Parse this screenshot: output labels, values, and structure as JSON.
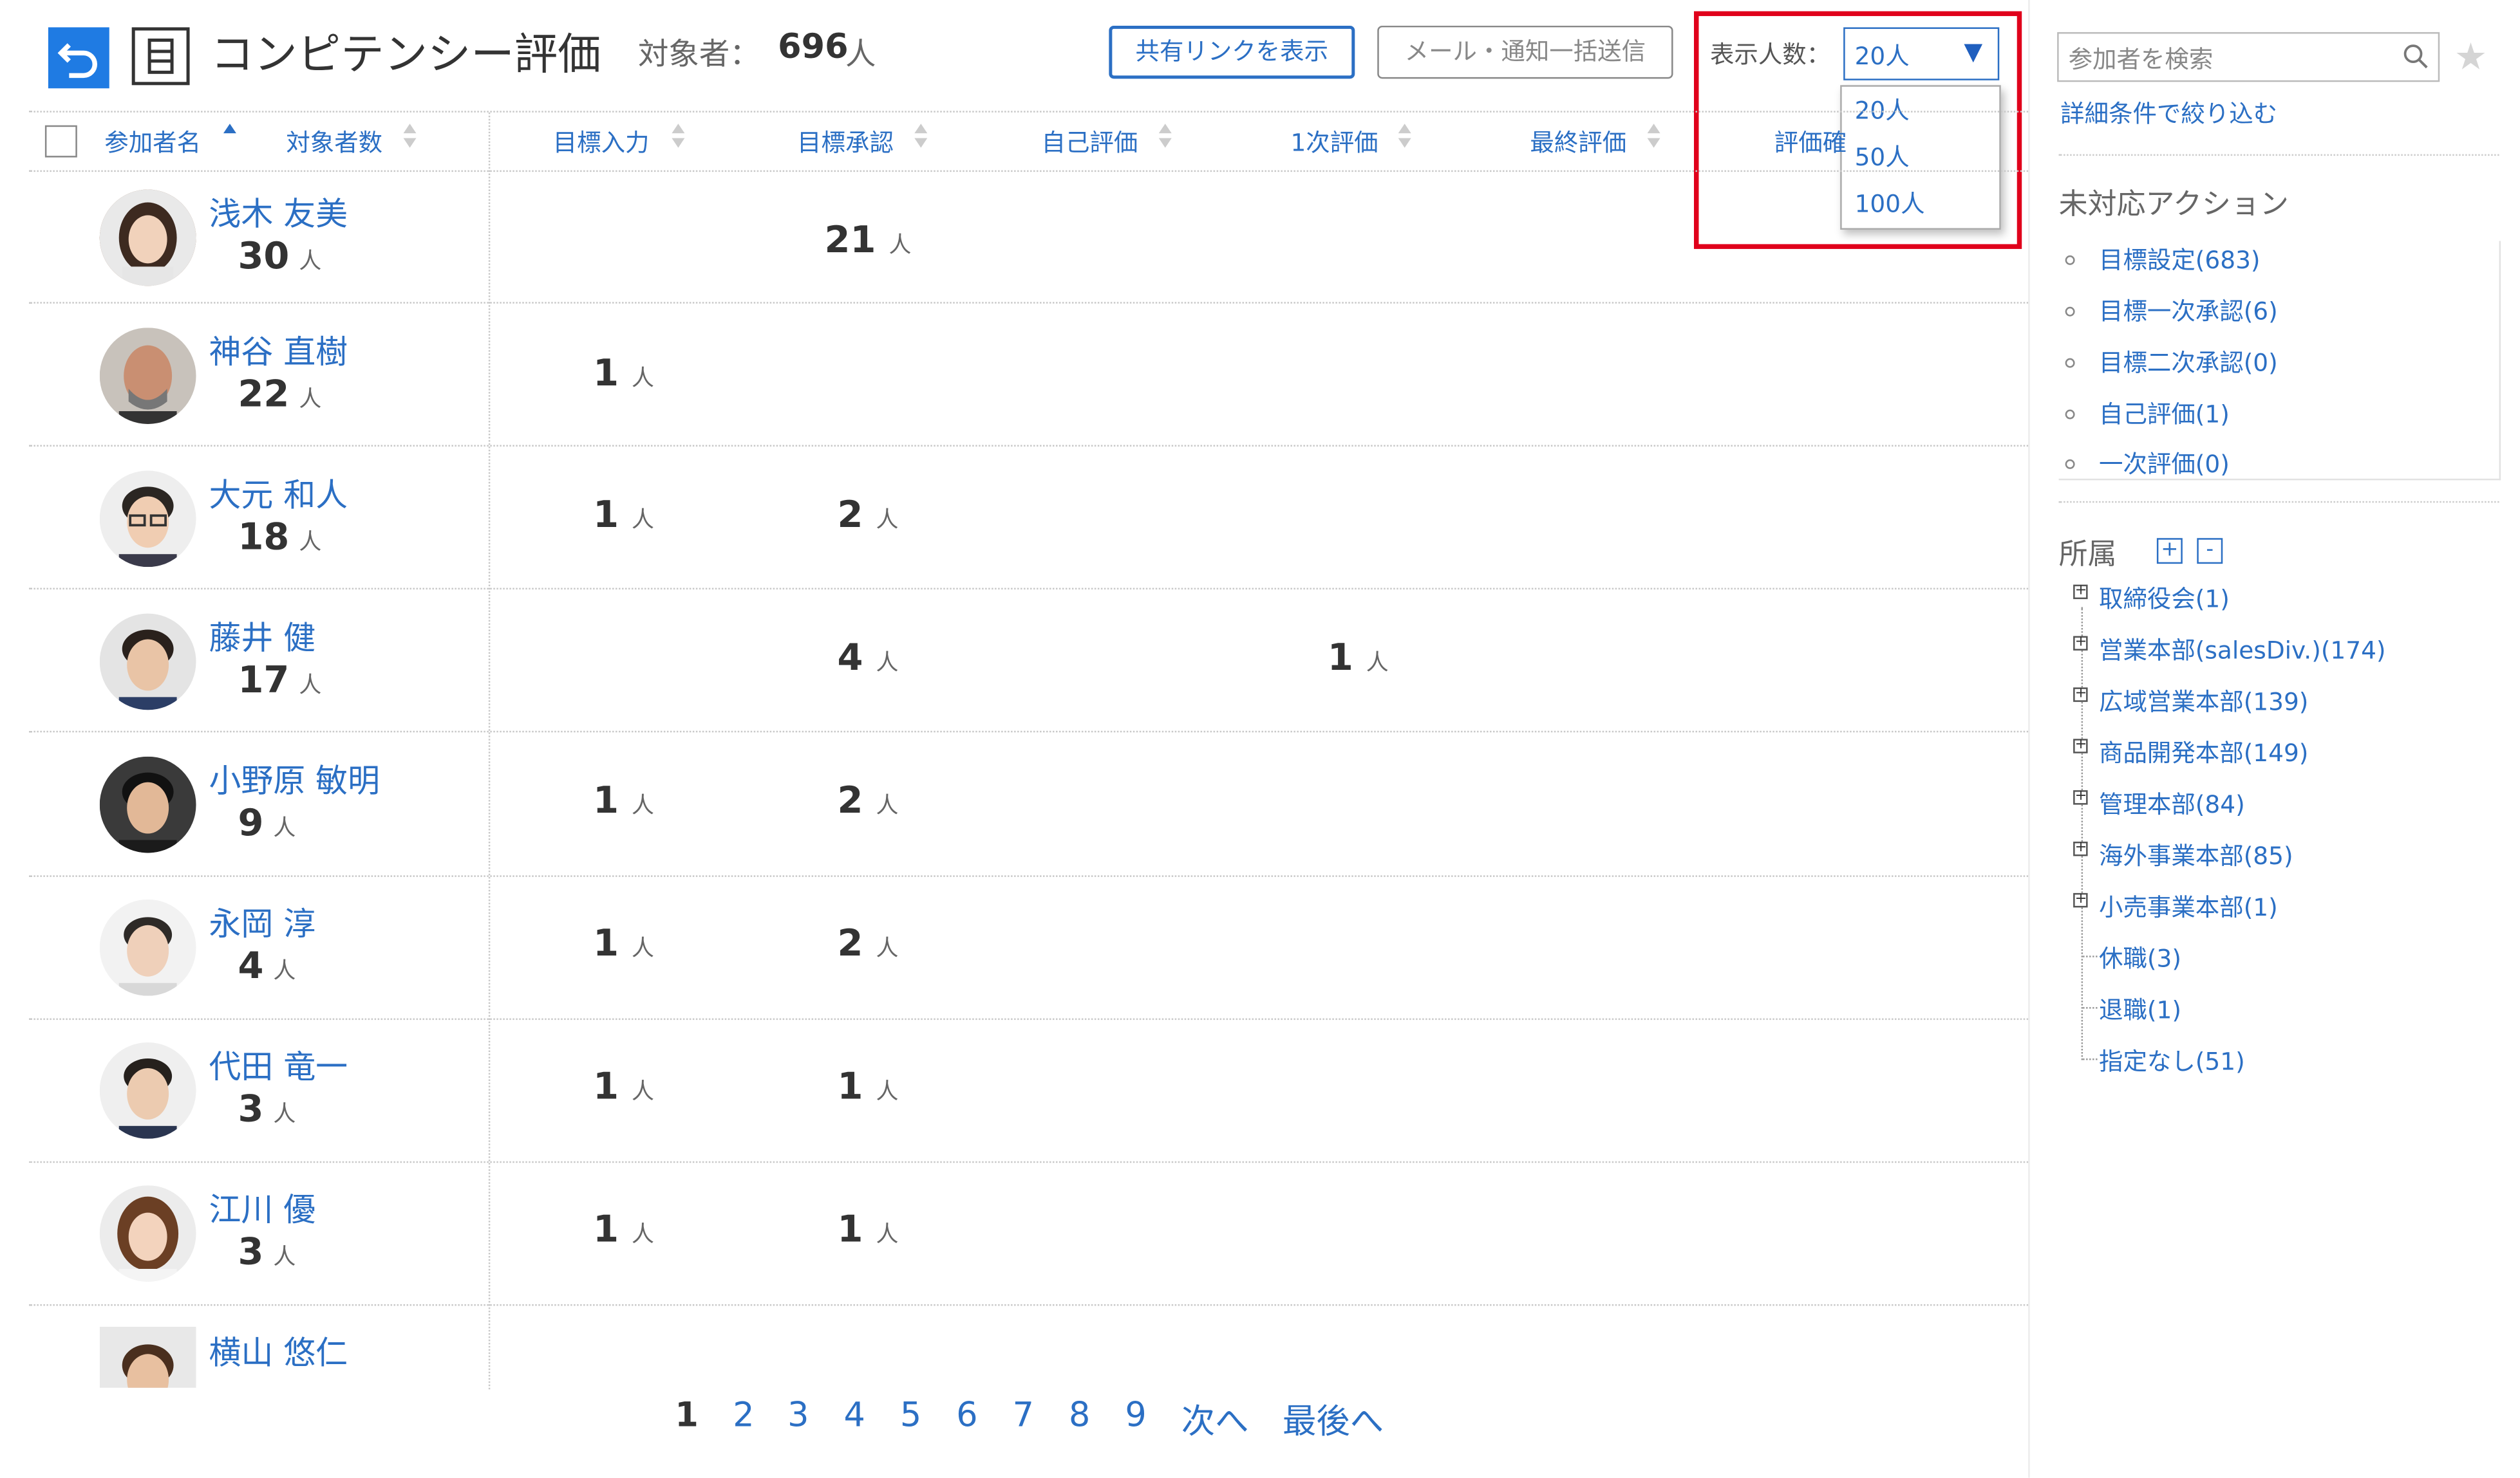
{
  "header": {
    "title": "コンピテンシー評価",
    "target_label": "対象者：",
    "target_count": "696",
    "target_unit": "人",
    "share_button": "共有リンクを表示",
    "mail_button": "メール・通知一括送信",
    "display_label": "表示人数：",
    "display_selected": "20人",
    "display_options": [
      "20人",
      "50人",
      "100人"
    ]
  },
  "table": {
    "columns": [
      "参加者名",
      "対象者数",
      "目標入力",
      "目標承認",
      "自己評価",
      "1次評価",
      "最終評価",
      "評価確"
    ],
    "unit": "人",
    "rows": [
      {
        "name": "浅木 友美",
        "count": "30",
        "goal_input": "",
        "goal_approval": "21",
        "self_eval": "",
        "first_eval": ""
      },
      {
        "name": "神谷 直樹",
        "count": "22",
        "goal_input": "1",
        "goal_approval": "",
        "self_eval": "",
        "first_eval": ""
      },
      {
        "name": "大元 和人",
        "count": "18",
        "goal_input": "1",
        "goal_approval": "2",
        "self_eval": "",
        "first_eval": ""
      },
      {
        "name": "藤井 健",
        "count": "17",
        "goal_input": "",
        "goal_approval": "4",
        "self_eval": "",
        "first_eval": "1"
      },
      {
        "name": "小野原 敏明",
        "count": "9",
        "goal_input": "1",
        "goal_approval": "2",
        "self_eval": "",
        "first_eval": ""
      },
      {
        "name": "永岡 淳",
        "count": "4",
        "goal_input": "1",
        "goal_approval": "2",
        "self_eval": "",
        "first_eval": ""
      },
      {
        "name": "代田 竜一",
        "count": "3",
        "goal_input": "1",
        "goal_approval": "1",
        "self_eval": "",
        "first_eval": ""
      },
      {
        "name": "江川 優",
        "count": "3",
        "goal_input": "1",
        "goal_approval": "1",
        "self_eval": "",
        "first_eval": ""
      },
      {
        "name": "横山 悠仁",
        "count": "",
        "goal_input": "",
        "goal_approval": "",
        "self_eval": "",
        "first_eval": ""
      }
    ]
  },
  "pagination": {
    "pages": [
      "1",
      "2",
      "3",
      "4",
      "5",
      "6",
      "7",
      "8",
      "9"
    ],
    "current": "1",
    "next": "次へ",
    "last": "最後へ"
  },
  "sidebar": {
    "search_placeholder": "参加者を検索",
    "refine_link": "詳細条件で絞り込む",
    "actions_title": "未対応アクション",
    "actions": [
      "目標設定(683)",
      "目標一次承認(6)",
      "目標二次承認(0)",
      "自己評価(1)",
      "一次評価(0)"
    ],
    "org_title": "所属",
    "org_expand": "+",
    "org_collapse": "-",
    "org_items": [
      {
        "label": "取締役会(1)",
        "expandable": true
      },
      {
        "label": "営業本部(salesDiv.)(174)",
        "expandable": true
      },
      {
        "label": "広域営業本部(139)",
        "expandable": true
      },
      {
        "label": "商品開発本部(149)",
        "expandable": true
      },
      {
        "label": "管理本部(84)",
        "expandable": true
      },
      {
        "label": "海外事業本部(85)",
        "expandable": true
      },
      {
        "label": "小売事業本部(1)",
        "expandable": true
      },
      {
        "label": "休職(3)",
        "expandable": false
      },
      {
        "label": "退職(1)",
        "expandable": false
      },
      {
        "label": "指定なし(51)",
        "expandable": false
      }
    ]
  },
  "colors": {
    "accent": "#2b6fc4",
    "back_button": "#1f7be3",
    "highlight_border": "#e0001b"
  }
}
